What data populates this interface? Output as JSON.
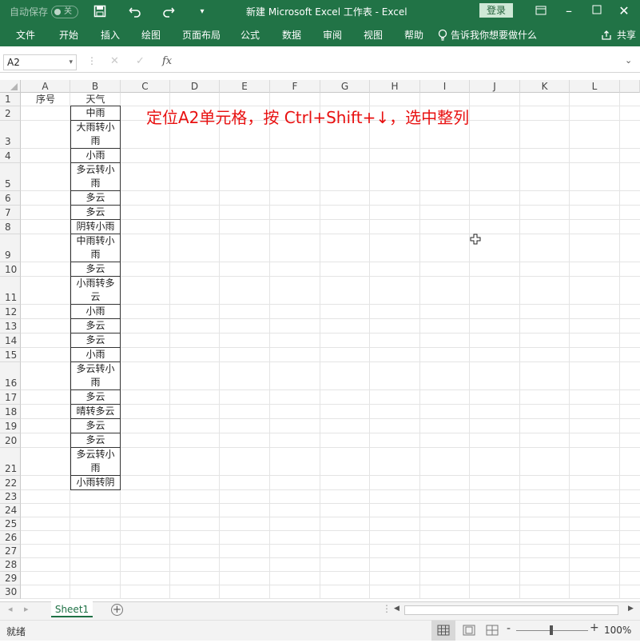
{
  "title_bar": {
    "autosave_label": "自动保存",
    "autosave_state": "关",
    "doc_title": "新建 Microsoft Excel 工作表  -  Excel",
    "login_label": "登录"
  },
  "ribbon": {
    "tabs": [
      "文件",
      "开始",
      "插入",
      "绘图",
      "页面布局",
      "公式",
      "数据",
      "审阅",
      "视图",
      "帮助"
    ],
    "tell_me": "告诉我你想要做什么",
    "share": "共享"
  },
  "formula_bar": {
    "name_box": "A2",
    "fx_label": "fx",
    "formula": ""
  },
  "grid": {
    "columns": [
      "A",
      "B",
      "C",
      "D",
      "E",
      "F",
      "G",
      "H",
      "I",
      "J",
      "K",
      "L"
    ],
    "header_a1": "序号",
    "header_b1": "天气",
    "weather": [
      "中雨",
      "大雨转小雨",
      "小雨",
      "多云转小雨",
      "多云",
      "多云",
      "阴转小雨",
      "中雨转小雨",
      "多云",
      "小雨转多云",
      "小雨",
      "多云",
      "多云",
      "小雨",
      "多云转小雨",
      "多云",
      "晴转多云",
      "多云",
      "多云",
      "多云转小雨",
      "小雨转阴"
    ],
    "annotation": "定位A2单元格，按 Ctrl+Shift+↓，选中整列",
    "annotation_color": "#e81010"
  },
  "sheet_tabs": {
    "active": "Sheet1"
  },
  "status_bar": {
    "ready": "就绪",
    "zoom": "100%"
  },
  "colors": {
    "excel_green": "#217346",
    "tab_green": "#1e7145"
  }
}
